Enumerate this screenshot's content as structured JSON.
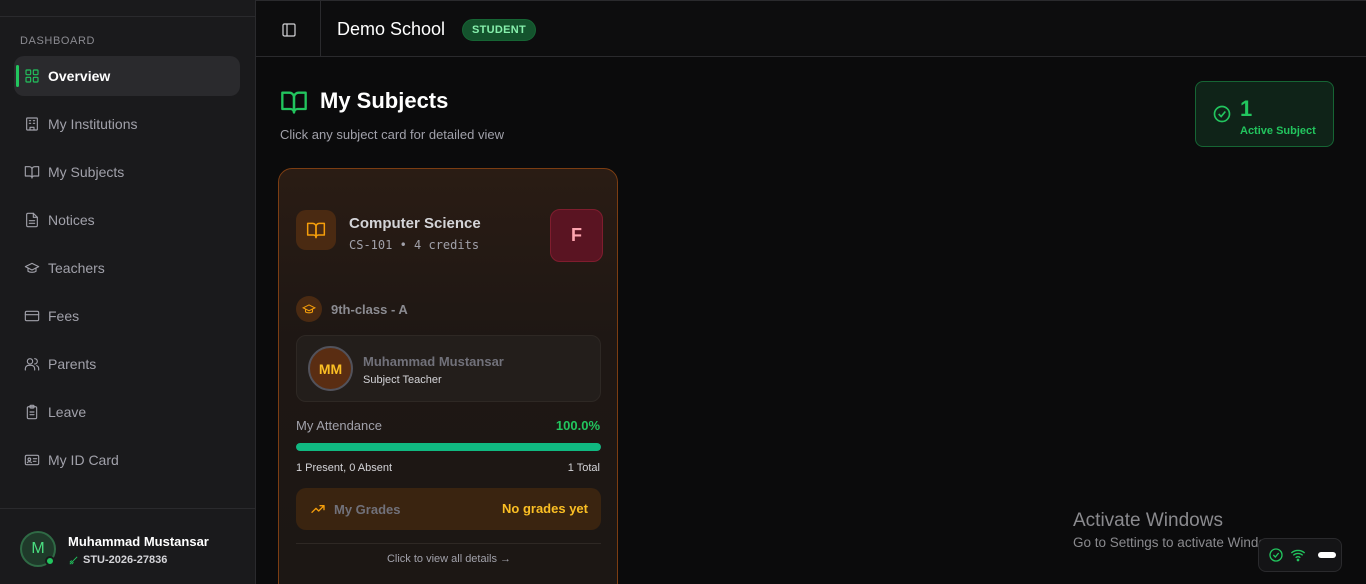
{
  "sidebar": {
    "section_label": "DASHBOARD",
    "items": [
      {
        "label": "Overview",
        "icon": "layout-grid-icon",
        "active": true
      },
      {
        "label": "My Institutions",
        "icon": "building-icon"
      },
      {
        "label": "My Subjects",
        "icon": "book-open-icon"
      },
      {
        "label": "Notices",
        "icon": "file-text-icon"
      },
      {
        "label": "Teachers",
        "icon": "graduation-cap-icon"
      },
      {
        "label": "Fees",
        "icon": "credit-card-icon"
      },
      {
        "label": "Parents",
        "icon": "users-icon"
      },
      {
        "label": "Leave",
        "icon": "clipboard-icon"
      },
      {
        "label": "My ID Card",
        "icon": "id-card-icon"
      }
    ],
    "user": {
      "initial": "M",
      "name": "Muhammad Mustansar",
      "id": "STU-2026-27836"
    }
  },
  "header": {
    "school_name": "Demo School",
    "role_badge": "STUDENT"
  },
  "main": {
    "title": "My Subjects",
    "subtitle": "Click any subject card for detailed view",
    "stat": {
      "count": "1",
      "label": "Active Subject"
    },
    "subject_card": {
      "name": "Computer Science",
      "code_credits": "CS-101 • 4 credits",
      "grade": "F",
      "class": "9th-class - A",
      "teacher": {
        "initials": "MM",
        "name": "Muhammad Mustansar",
        "role": "Subject Teacher"
      },
      "attendance": {
        "label": "My Attendance",
        "value": "100.0%",
        "fraction": 1.0,
        "present_absent": "1 Present, 0 Absent",
        "total": "1 Total"
      },
      "grades": {
        "label": "My Grades",
        "value": "No grades yet"
      },
      "footer": "Click to view all details →"
    }
  },
  "watermark": {
    "title": "Activate Windows",
    "subtitle": "Go to Settings to activate Windows."
  },
  "colors": {
    "accent": "#22c55e",
    "subject_accent": "#f59e0b",
    "grade_bg": "#5a1422"
  }
}
